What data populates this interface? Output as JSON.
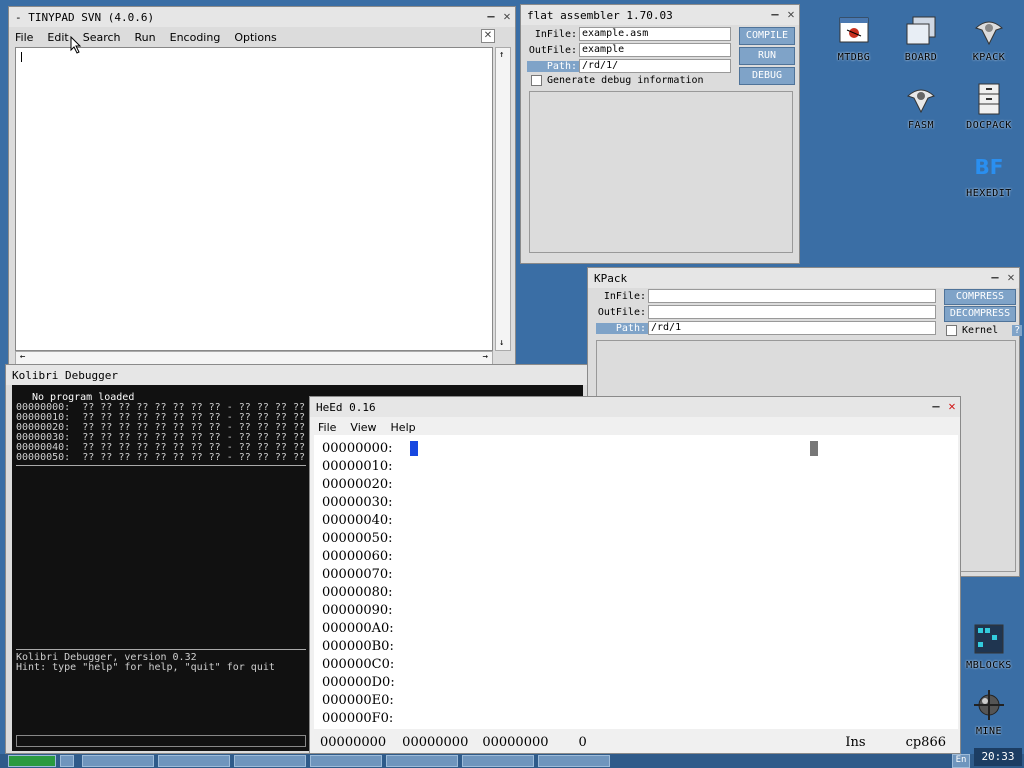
{
  "colors": {
    "desktop": "#3a6ea5",
    "accent": "#7fa3c8",
    "close_red": "#d01010"
  },
  "desktop_icons": [
    {
      "label": "MTDBG",
      "icon": "bug-window-icon"
    },
    {
      "label": "BOARD",
      "icon": "board-windows-icon"
    },
    {
      "label": "KPACK",
      "icon": "kpack-icon"
    },
    {
      "label": "FASM",
      "icon": "fasm-icon"
    },
    {
      "label": "DOCPACK",
      "icon": "docpack-cabinet-icon"
    },
    {
      "label": "HEXEDIT",
      "icon": "hexedit-icon"
    },
    {
      "label": "MBLOCKS",
      "icon": "mblocks-grid-icon"
    },
    {
      "label": "MINE",
      "icon": "mine-icon"
    }
  ],
  "tinypad": {
    "title": "- TINYPAD SVN (4.0.6)",
    "menu": [
      "File",
      "Edit",
      "Search",
      "Run",
      "Encoding",
      "Options"
    ],
    "controls": {
      "minimize": "—",
      "close": "✕",
      "tab_close": "✕"
    }
  },
  "fasm": {
    "title": "flat assembler 1.70.03",
    "infile_label": "InFile:",
    "infile_value": "example.asm",
    "outfile_label": "OutFile:",
    "outfile_value": "example",
    "path_label": "Path:",
    "path_value": "/rd/1/",
    "debug_info_label": "Generate debug information",
    "buttons": {
      "compile": "COMPILE",
      "run": "RUN",
      "debug": "DEBUG"
    }
  },
  "kpack": {
    "title": "KPack",
    "infile_label": "InFile:",
    "outfile_label": "OutFile:",
    "path_label": "Path:",
    "path_value": "/rd/1",
    "buttons": {
      "compress": "COMPRESS",
      "decompress": "DECOMPRESS"
    },
    "kernel_label": "Kernel",
    "help_label": "?"
  },
  "debugger": {
    "title": "Kolibri Debugger",
    "status": "No program loaded",
    "dump_rows": [
      "00000000:  ?? ?? ?? ?? ?? ?? ?? ?? - ?? ?? ?? ??",
      "00000010:  ?? ?? ?? ?? ?? ?? ?? ?? - ?? ?? ?? ??",
      "00000020:  ?? ?? ?? ?? ?? ?? ?? ?? - ?? ?? ?? ??",
      "00000030:  ?? ?? ?? ?? ?? ?? ?? ?? - ?? ?? ?? ??",
      "00000040:  ?? ?? ?? ?? ?? ?? ?? ?? - ?? ?? ?? ??",
      "00000050:  ?? ?? ?? ?? ?? ?? ?? ?? - ?? ?? ?? ??"
    ],
    "version_line": "Kolibri Debugger, version 0.32",
    "hint_line": "Hint: type \"help\" for help, \"quit\" for quit"
  },
  "heed": {
    "title": "HeEd 0.16",
    "menu": [
      "File",
      "View",
      "Help"
    ],
    "offsets": [
      "00000000:",
      "00000010:",
      "00000020:",
      "00000030:",
      "00000040:",
      "00000050:",
      "00000060:",
      "00000070:",
      "00000080:",
      "00000090:",
      "000000A0:",
      "000000B0:",
      "000000C0:",
      "000000D0:",
      "000000E0:",
      "000000F0:"
    ],
    "status": {
      "pos1": "00000000",
      "pos2": "00000000",
      "pos3": "00000000",
      "value": "0",
      "mode": "Ins",
      "codepage": "cp866"
    }
  },
  "taskbar": {
    "clock": "20:33",
    "lang": "En"
  }
}
